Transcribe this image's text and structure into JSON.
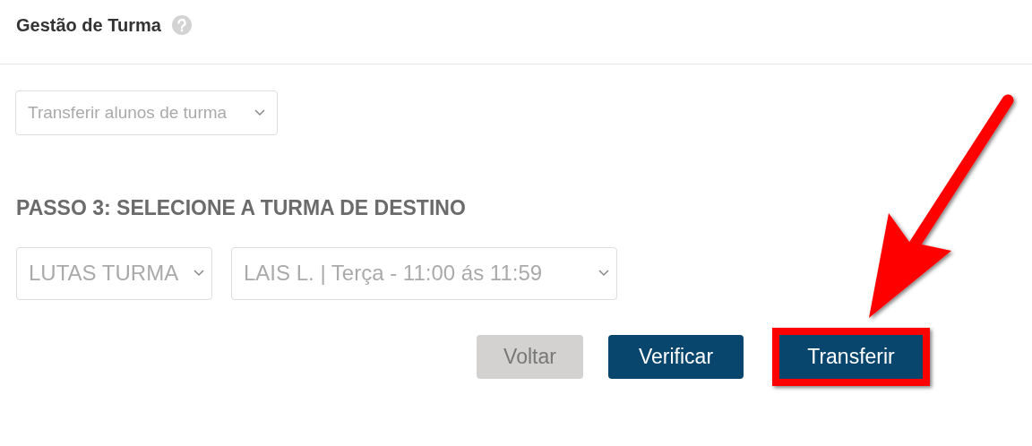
{
  "header": {
    "title": "Gestão de Turma"
  },
  "action_select": {
    "value": "Transferir alunos de turma"
  },
  "step": {
    "heading": "PASSO 3: SELECIONE A TURMA DE DESTINO"
  },
  "destination_selects": [
    {
      "value": "LUTAS TURMA"
    },
    {
      "value": "LAIS L. | Terça - 11:00 ás 11:59"
    }
  ],
  "buttons": [
    {
      "label": "Voltar",
      "disabled": true,
      "highlighted": false
    },
    {
      "label": "Verificar",
      "disabled": false,
      "highlighted": false
    },
    {
      "label": "Transferir",
      "disabled": false,
      "highlighted": true
    }
  ]
}
